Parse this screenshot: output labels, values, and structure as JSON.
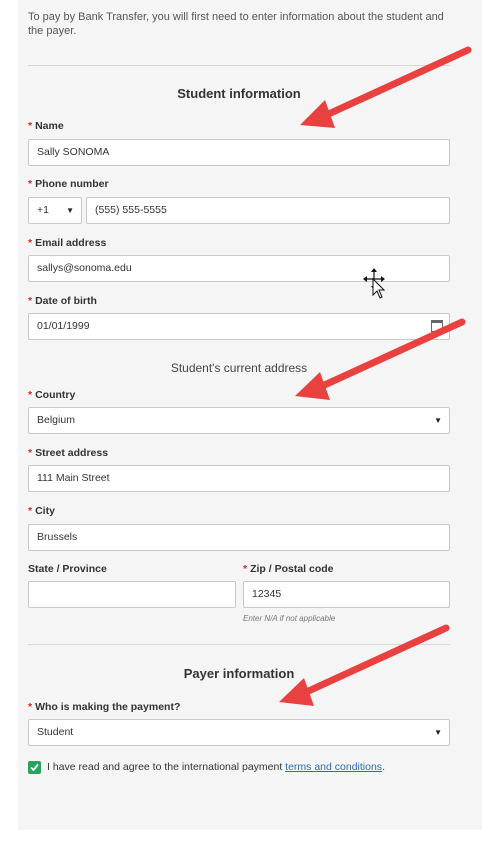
{
  "intro": "To pay by Bank Transfer, you will first need to enter information about the student and the payer.",
  "student_section": {
    "title": "Student information",
    "name_label": "Name",
    "name_value": "Sally SONOMA",
    "phone_label": "Phone number",
    "phone_code": "+1",
    "phone_value": "(555) 555-5555",
    "email_label": "Email address",
    "email_value": "sallys@sonoma.edu",
    "dob_label": "Date of birth",
    "dob_value": "01/01/1999"
  },
  "address_section": {
    "title": "Student's current address",
    "country_label": "Country",
    "country_value": "Belgium",
    "street_label": "Street address",
    "street_value": "111 Main Street",
    "city_label": "City",
    "city_value": "Brussels",
    "state_label": "State / Province",
    "state_value": "",
    "zip_label": "Zip / Postal code",
    "zip_value": "12345",
    "zip_hint": "Enter N/A if not applicable"
  },
  "payer_section": {
    "title": "Payer information",
    "who_label": "Who is making the payment?",
    "who_value": "Student"
  },
  "agreement": {
    "text": "I have read and agree to the international payment ",
    "link": "terms and conditions",
    "end": "."
  },
  "required_marker": "*",
  "icons": {
    "dropdown": "chevron-down-icon",
    "calendar": "calendar-icon",
    "check": "check-icon",
    "cursor": "move-cursor-icon",
    "annotation": "red-arrow-annotation"
  },
  "colors": {
    "required": "#d9252a",
    "checkbox": "#2aa35a",
    "link": "#2a6db3",
    "arrow": "#e8413f"
  }
}
